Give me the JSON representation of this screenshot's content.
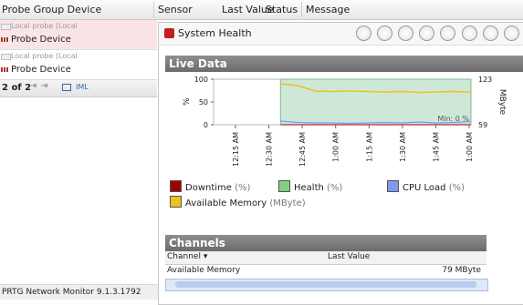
{
  "grid_header": {
    "col_device": "Probe Group Device",
    "col_sensor": "Sensor",
    "col_last_value": "Last Value",
    "col_status": "Status",
    "col_message": "Message"
  },
  "devices": [
    {
      "sub": "Local probe (Local",
      "name": "Probe Device"
    },
    {
      "sub": "Local probe (Local",
      "name": "Probe Device"
    }
  ],
  "pager": {
    "text": "2 of 2",
    "extra": "IML"
  },
  "footer": {
    "status": "PRTG Network Monitor 9.1.3.1792"
  },
  "panel": {
    "title": "System Health",
    "live_section": "Live Data",
    "channels_section": "Channels"
  },
  "chart_data": {
    "type": "area",
    "x_ticks": [
      "12:15 AM",
      "12:30 AM",
      "12:45 AM",
      "1:00 AM",
      "1:15 AM",
      "1:30 AM",
      "1:45 AM",
      "1:00 AM"
    ],
    "y_left": {
      "label": "%",
      "ticks": [
        100,
        50,
        0
      ]
    },
    "y_right": {
      "label": "MByte",
      "top": "123",
      "bottom": "59"
    },
    "min_label": "Min: 0 %",
    "series": [
      {
        "name": "Downtime",
        "unit": "(%)",
        "color": "#a00000",
        "values": [
          0,
          0,
          0,
          0,
          0,
          0,
          0,
          0,
          0,
          0,
          0,
          0
        ]
      },
      {
        "name": "Health",
        "unit": "(%)",
        "color": "#80d080",
        "values": [
          100,
          100,
          100,
          100,
          100,
          100,
          100,
          100,
          100,
          100,
          100,
          100
        ]
      },
      {
        "name": "CPU Load",
        "unit": "(%)",
        "color": "#8099ee",
        "values": [
          8,
          5,
          4,
          4,
          3,
          4,
          5,
          4,
          6,
          4,
          5,
          7
        ]
      },
      {
        "name": "Available Memory",
        "unit": "(MByte)",
        "color": "#f0c020",
        "values": [
          90,
          86,
          74,
          73,
          74,
          73,
          72,
          73,
          71,
          72,
          73,
          72
        ]
      }
    ]
  },
  "channels_table": {
    "col_channel": "Channel",
    "col_last_value": "Last Value",
    "rows": [
      {
        "channel": "Available Memory",
        "value": "79 MByte"
      }
    ]
  }
}
